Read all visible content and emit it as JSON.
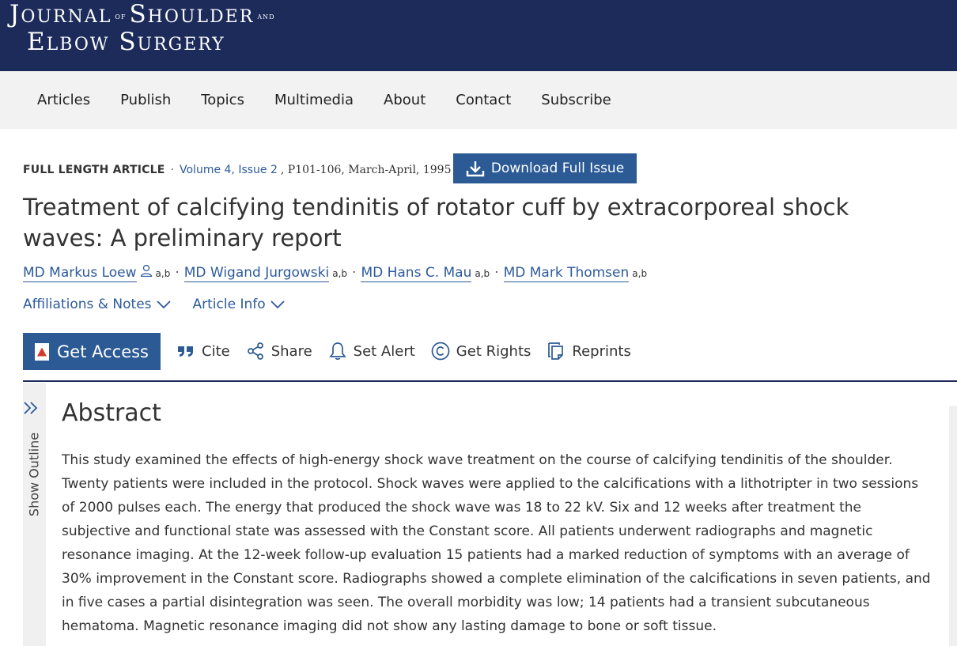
{
  "journal": {
    "logo_line1_a": "Journal",
    "logo_line1_of": "of",
    "logo_line1_b": "Shoulder",
    "logo_line1_and": "and",
    "logo_line2": "Elbow Surgery",
    "colors": {
      "masthead": "#1c2b5a",
      "accent": "#2b5a94"
    }
  },
  "nav": [
    "Articles",
    "Publish",
    "Topics",
    "Multimedia",
    "About",
    "Contact",
    "Subscribe"
  ],
  "article": {
    "type": "FULL LENGTH ARTICLE",
    "volume": "Volume 4, Issue 2",
    "pages_date": ", P101-106, March-April, 1995",
    "download_label": "Download Full Issue",
    "title": "Treatment of calcifying tendinitis of rotator cuff by extracorporeal shock waves: A preliminary report",
    "authors": [
      {
        "name": "MD Markus Loew",
        "sup": "a,b",
        "icon": "person-icon"
      },
      {
        "name": "MD Wigand Jurgowski",
        "sup": "a,b"
      },
      {
        "name": "MD Hans C. Mau",
        "sup": "a,b"
      },
      {
        "name": "MD Mark Thomsen",
        "sup": "a,b"
      }
    ],
    "affiliations_label": "Affiliations & Notes",
    "article_info_label": "Article Info"
  },
  "actions": {
    "get_access": "Get Access",
    "cite": "Cite",
    "share": "Share",
    "set_alert": "Set Alert",
    "get_rights": "Get Rights",
    "reprints": "Reprints"
  },
  "outline": {
    "label": "Show Outline"
  },
  "abstract": {
    "heading": "Abstract",
    "text": "This study examined the effects of high-energy shock wave treatment on the course of calcifying tendinitis of the shoulder. Twenty patients were included in the protocol. Shock waves were applied to the calcifications with a lithotripter in two sessions of 2000 pulses each. The energy that produced the shock wave was 18 to 22 kV. Six and 12 weeks after treatment the subjective and functional state was assessed with the Constant score. All patients underwent radiographs and magnetic resonance imaging. At the 12-week follow-up evaluation 15 patients had a marked reduction of symptoms with an average of 30% improvement in the Constant score. Radiographs showed a complete elimination of the calcifications in seven patients, and in five cases a partial disintegration was seen. The overall morbidity was low; 14 patients had a transient subcutaneous hematoma. Magnetic resonance imaging did not show any lasting damage to bone or soft tissue."
  }
}
